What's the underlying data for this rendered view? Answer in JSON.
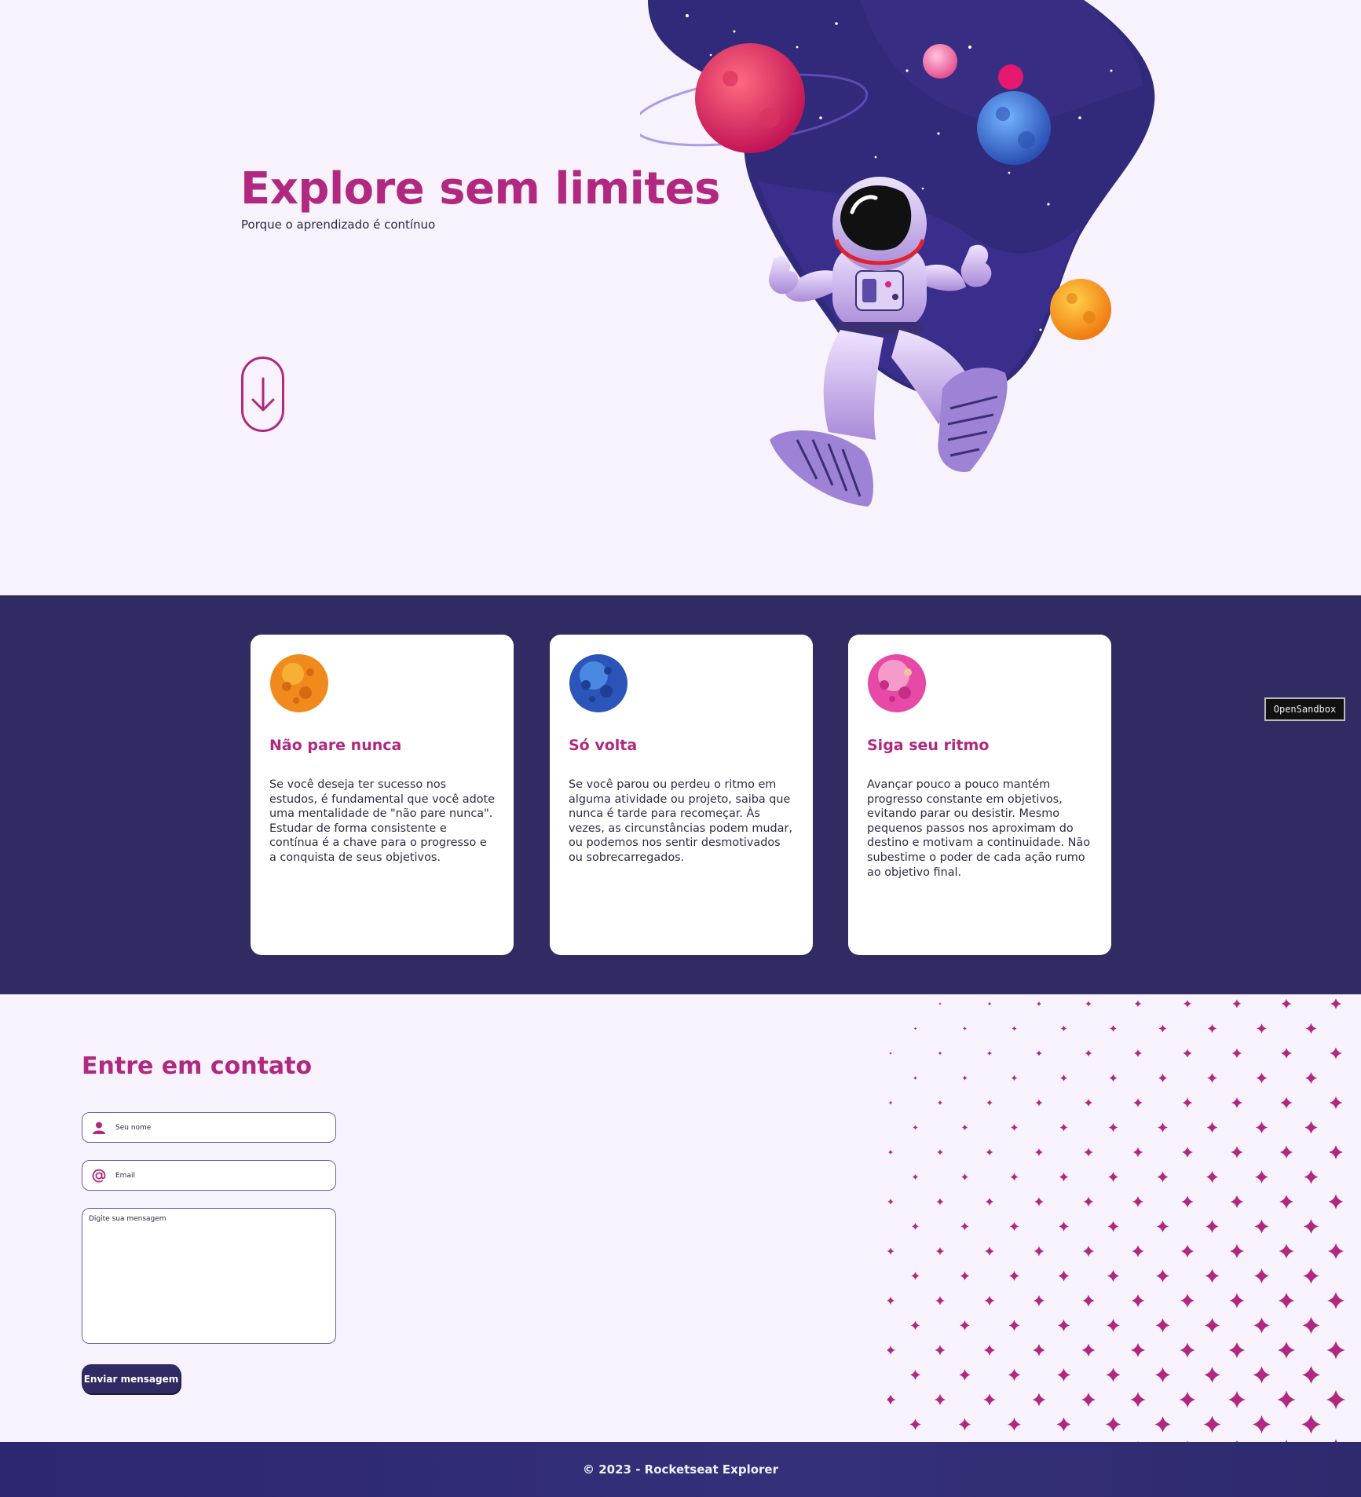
{
  "hero": {
    "title": "Explore sem limites",
    "subtitle": "Porque o aprendizado é contínuo",
    "scroll_icon": "arrow-down-icon",
    "illustration": "astronaut-in-space-illustration"
  },
  "cards": [
    {
      "icon": "orange-planet-icon",
      "planet_color": "#f08a1c",
      "title": "Não pare nunca",
      "text": "Se você deseja ter sucesso nos estudos, é fundamental que você adote uma mentalidade de \"não pare nunca\". Estudar de forma consistente e contínua é a chave para o progresso e a conquista de seus objetivos."
    },
    {
      "icon": "blue-planet-icon",
      "planet_color": "#2f6fd0",
      "title": "Só volta",
      "text": "Se você parou ou perdeu o ritmo em alguma atividade ou projeto, saiba que nunca é tarde para recomeçar. Às vezes, as circunstâncias podem mudar, ou podemos nos sentir desmotivados ou sobrecarregados."
    },
    {
      "icon": "pink-planet-icon",
      "planet_color": "#e64aa6",
      "title": "Siga seu ritmo",
      "text": "Avançar pouco a pouco mantém progresso constante em objetivos, evitando parar ou desistir. Mesmo pequenos passos nos aproximam do destino e motivam a continuidade. Não subestime o poder de cada ação rumo ao objetivo final."
    }
  ],
  "badge": {
    "label": "OpenSandbox"
  },
  "contact": {
    "title": "Entre em contato",
    "name_placeholder": "Seu nome",
    "name_icon": "user-icon",
    "email_placeholder": "Email",
    "email_icon": "at-sign-icon",
    "message_placeholder": "Digite sua mensagem",
    "submit_label": "Enviar mensagem",
    "decoration": "sparkle-stars-pattern"
  },
  "footer": {
    "text": "© 2023 - Rocketseat Explorer"
  },
  "colors": {
    "accent": "#b0287f",
    "primary": "#302b63",
    "background": "#f7f2fb",
    "text": "#2b2a45"
  }
}
